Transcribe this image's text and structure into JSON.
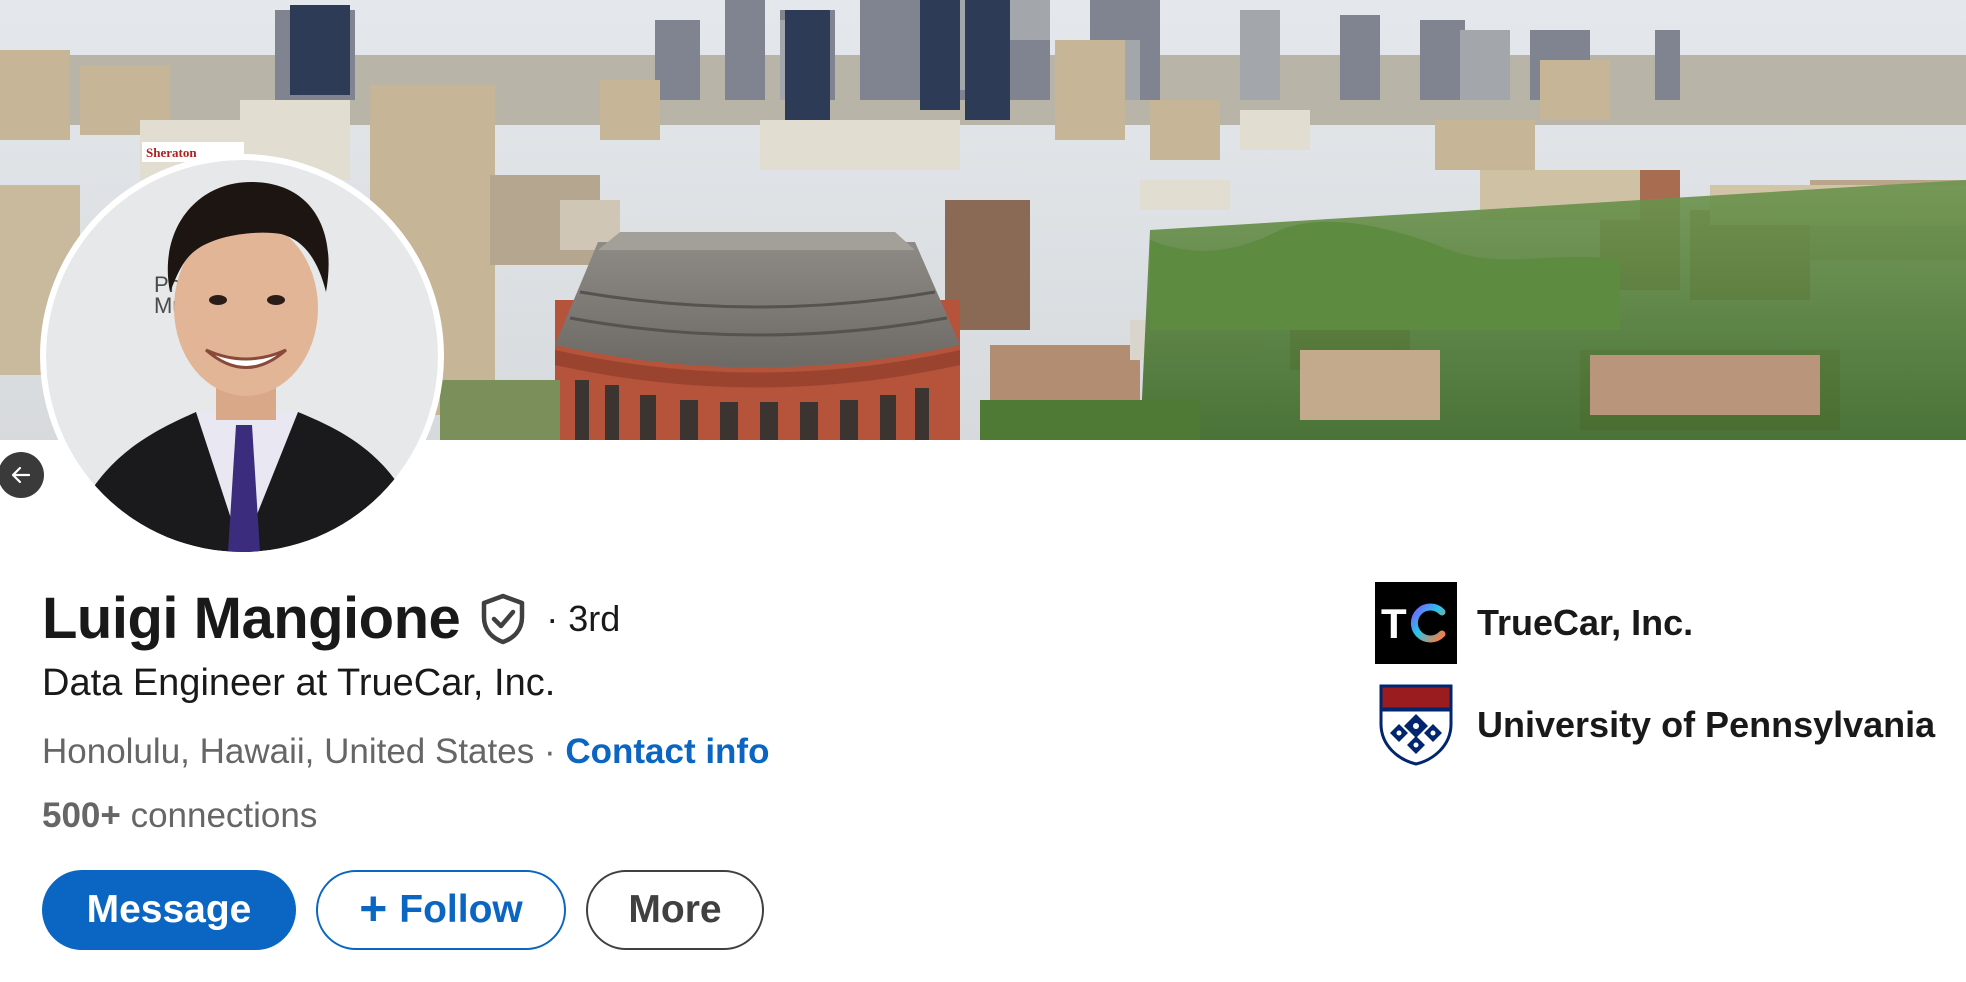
{
  "profile": {
    "name": "Luigi Mangione",
    "degree": "· 3rd",
    "headline": "Data Engineer at TrueCar, Inc.",
    "location": "Honolulu, Hawaii, United States",
    "separator": " · ",
    "contact_label": "Contact info",
    "connections_count": "500+",
    "connections_label": " connections"
  },
  "actions": {
    "message_label": "Message",
    "follow_plus": "+",
    "follow_label": "Follow",
    "more_label": "More"
  },
  "experience": [
    {
      "name": "TrueCar, Inc.",
      "logo_text": "TC"
    },
    {
      "name": "University of Pennsylvania"
    }
  ],
  "banner": {
    "sign_text": "Sheraton"
  },
  "avatar": {
    "backdrop_text_line1": "Philad",
    "backdrop_text_line2": "Muse"
  },
  "colors": {
    "primary": "#0a66c2",
    "text": "#191919",
    "muted": "#666666",
    "upenn_red": "#9b1c1f",
    "upenn_blue": "#01256e"
  },
  "icons": {
    "back": "arrow-left-icon",
    "verified": "shield-check-icon"
  }
}
